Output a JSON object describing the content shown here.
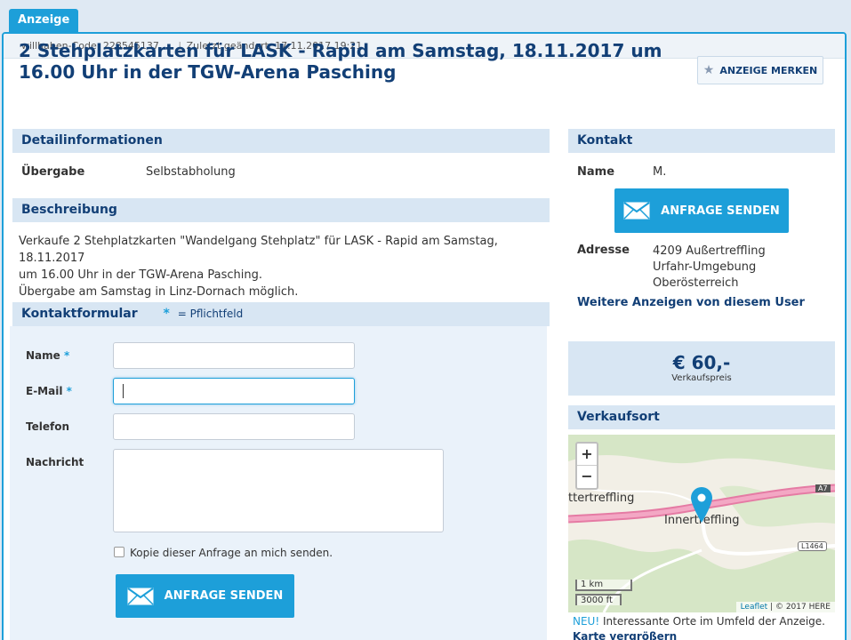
{
  "tab_label": "Anzeige",
  "meta": {
    "code": "willhaben-Code: 228545137",
    "changed": "Zuletzt geändert: 17.11.2017 19:21"
  },
  "title": "2 Stehplatzkarten für LASK - Rapid am Samstag, 18.11.2017 um 16.00 Uhr in der TGW-Arena Pasching",
  "merken_label": "ANZEIGE MERKEN",
  "details": {
    "heading": "Detailinformationen",
    "label": "Übergabe",
    "value": "Selbstabholung"
  },
  "description": {
    "heading": "Beschreibung",
    "lines": [
      "Verkaufe 2 Stehplatzkarten \"Wandelgang Stehplatz\" für LASK - Rapid am Samstag, 18.11.2017",
      "um 16.00 Uhr in der TGW-Arena Pasching.",
      "Übergabe am Samstag in Linz-Dornach möglich."
    ]
  },
  "form": {
    "heading": "Kontaktformular",
    "required_star": "*",
    "required_note": "= Pflichtfeld",
    "name_label": "Name",
    "email_label": "E-Mail",
    "phone_label": "Telefon",
    "message_label": "Nachricht",
    "copy_label": "Kopie dieser Anfrage an mich senden.",
    "submit_label": "ANFRAGE SENDEN"
  },
  "contact": {
    "heading": "Kontakt",
    "name_label": "Name",
    "name_value": "M.",
    "button_label": "ANFRAGE SENDEN",
    "address_label": "Adresse",
    "address_lines": [
      "4209 Außertreffling",
      "Urfahr-Umgebung",
      "Oberösterreich"
    ],
    "more_ads": "Weitere Anzeigen von diesem User"
  },
  "price": {
    "value": "€ 60,-",
    "label": "Verkaufspreis"
  },
  "location": {
    "heading": "Verkaufsort",
    "map_labels": {
      "place1": "ttertreffling",
      "place2": "Innertreffling",
      "road1": "A7",
      "road2": "L1464"
    },
    "zoom_in": "+",
    "zoom_out": "−",
    "scale_km": "1 km",
    "scale_ft": "3000 ft",
    "attribution_leaflet": "Leaflet",
    "attribution_rest": " | © 2017 HERE",
    "new_tag": "NEU!",
    "new_text": " Interessante Orte im Umfeld der Anzeige.",
    "enlarge": "Karte vergrößern"
  }
}
